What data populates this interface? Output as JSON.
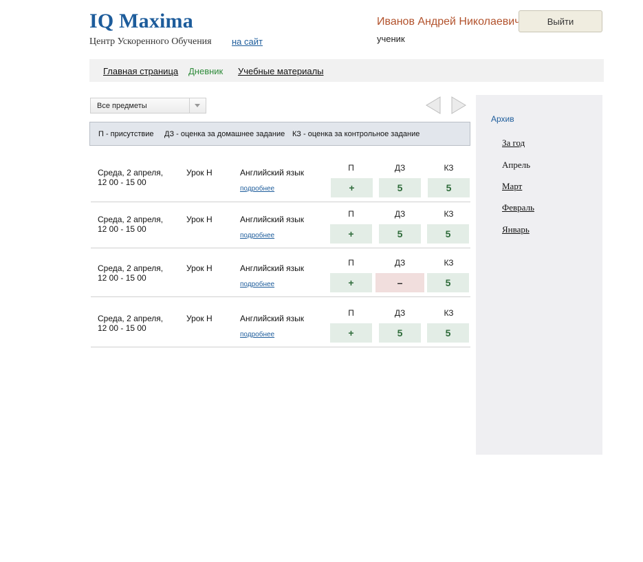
{
  "header": {
    "logo": "IQ Maxima",
    "subtitle": "Центр Ускоренного Обучения",
    "site_link": "на сайт",
    "user_name": "Иванов Андрей Николаевич",
    "user_role": "ученик",
    "logout_label": "Выйти"
  },
  "nav": {
    "items": [
      {
        "label": "Главная страница"
      },
      {
        "label": "Дневник"
      },
      {
        "label": "Учебные материалы"
      }
    ]
  },
  "filter": {
    "selected": "Все предметы"
  },
  "legend": {
    "p": "П - присутствие",
    "dz": "ДЗ - оценка за домашнее задание",
    "kz": "КЗ - оценка за контрольное задание"
  },
  "marks_headers": [
    "П",
    "ДЗ",
    "КЗ"
  ],
  "lessons": [
    {
      "date": "Среда, 2 апреля,",
      "time": "12 00 - 15 00",
      "lesson": "Урок Н",
      "subject": "Английский язык",
      "more": "подробнее",
      "p": "+",
      "dz": "5",
      "kz": "5"
    },
    {
      "date": "Среда, 2 апреля,",
      "time": "12 00 - 15 00",
      "lesson": "Урок Н",
      "subject": "Английский язык",
      "more": "подробнее",
      "p": "+",
      "dz": "5",
      "kz": "5"
    },
    {
      "date": "Среда, 2 апреля,",
      "time": "12 00 - 15 00",
      "lesson": "Урок Н",
      "subject": "Английский язык",
      "more": "подробнее",
      "p": "+",
      "dz": "–",
      "kz": "5"
    },
    {
      "date": "Среда, 2 апреля,",
      "time": "12 00 - 15 00",
      "lesson": "Урок Н",
      "subject": "Английский язык",
      "more": "подробнее",
      "p": "+",
      "dz": "5",
      "kz": "5"
    }
  ],
  "archive": {
    "title": "Архив",
    "items": [
      {
        "label": "За год"
      },
      {
        "label": "Апрель"
      },
      {
        "label": "Март"
      },
      {
        "label": "Февраль"
      },
      {
        "label": "Январь"
      }
    ]
  },
  "colors": {
    "brand": "#1d5c9b",
    "user_name": "#b2522c",
    "active_nav": "#2e8b3a",
    "mark_good_bg": "#e3ede6",
    "mark_bad_bg": "#f1dedd",
    "sidebar_bg": "#efeff2"
  }
}
